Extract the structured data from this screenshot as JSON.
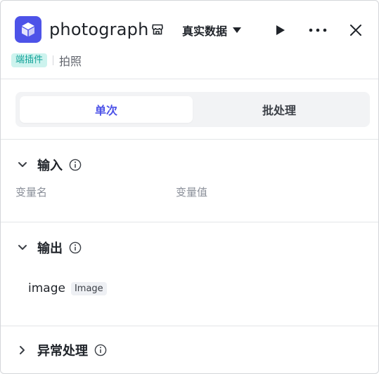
{
  "colors": {
    "accent": "#4d53e8",
    "tag": "#14a39a"
  },
  "header": {
    "icon": "cube-icon",
    "title": "photograph",
    "data_mode": "真实数据",
    "tag": "端插件",
    "subtitle": "拍照"
  },
  "tabs": [
    {
      "label": "单次",
      "active": true
    },
    {
      "label": "批处理",
      "active": false
    }
  ],
  "input_section": {
    "title": "输入",
    "expanded": true,
    "col_name": "变量名",
    "col_value": "变量值"
  },
  "output_section": {
    "title": "输出",
    "expanded": true,
    "items": [
      {
        "name": "image",
        "type": "Image"
      }
    ]
  },
  "error_section": {
    "title": "异常处理",
    "expanded": false
  }
}
